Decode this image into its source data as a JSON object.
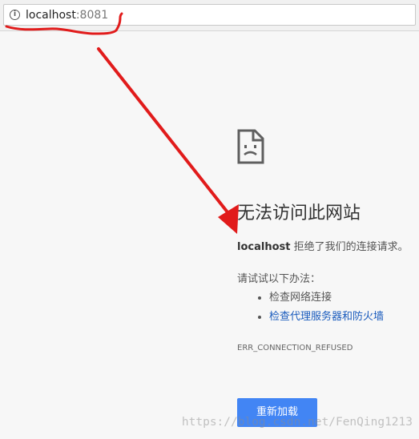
{
  "address_bar": {
    "host": "localhost",
    "port": ":8081"
  },
  "error_page": {
    "icon": "sad-page-icon",
    "title": "无法访问此网站",
    "message_host": "localhost",
    "message_rest": " 拒绝了我们的连接请求。",
    "suggestions_heading": "请试试以下办法：",
    "suggestions": [
      "检查网络连接",
      "检查代理服务器和防火墙"
    ],
    "error_code": "ERR_CONNECTION_REFUSED",
    "reload_label": "重新加载"
  },
  "annotation": {
    "color": "#e11b1b"
  },
  "watermark": "https://blog.csdn.net/FenQing1213"
}
